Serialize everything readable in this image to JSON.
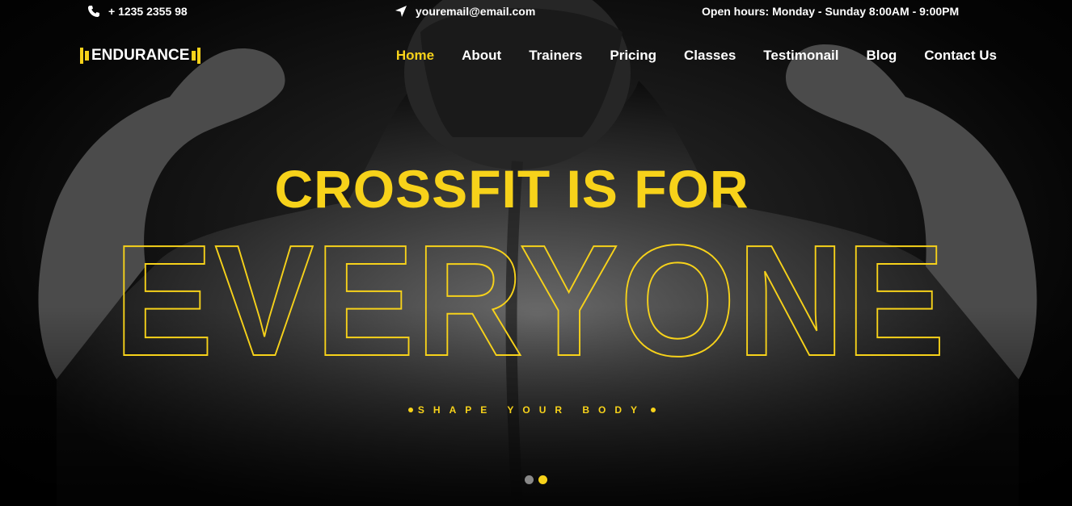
{
  "topbar": {
    "phone": "+ 1235 2355 98",
    "email": "youremail@email.com",
    "hours": "Open hours: Monday - Sunday 8:00AM - 9:00PM",
    "phone_icon": "phone-icon",
    "email_icon": "location-arrow-icon"
  },
  "brand": {
    "name": "ENDURANCE",
    "icon": "dumbbell-icon"
  },
  "nav": {
    "items": [
      "Home",
      "About",
      "Trainers",
      "Pricing",
      "Classes",
      "Testimonail",
      "Blog",
      "Contact Us"
    ],
    "active": "Home"
  },
  "hero": {
    "headline": "CROSSFIT IS FOR",
    "outline_word": "EVERYONE",
    "tagline": "SHAPE YOUR BODY"
  },
  "carousel": {
    "total_slides": 2,
    "active_slide": 2
  },
  "colors": {
    "accent": "#f7d21a",
    "background": "#000000",
    "text": "#ffffff",
    "inactive_dot": "#888888"
  }
}
